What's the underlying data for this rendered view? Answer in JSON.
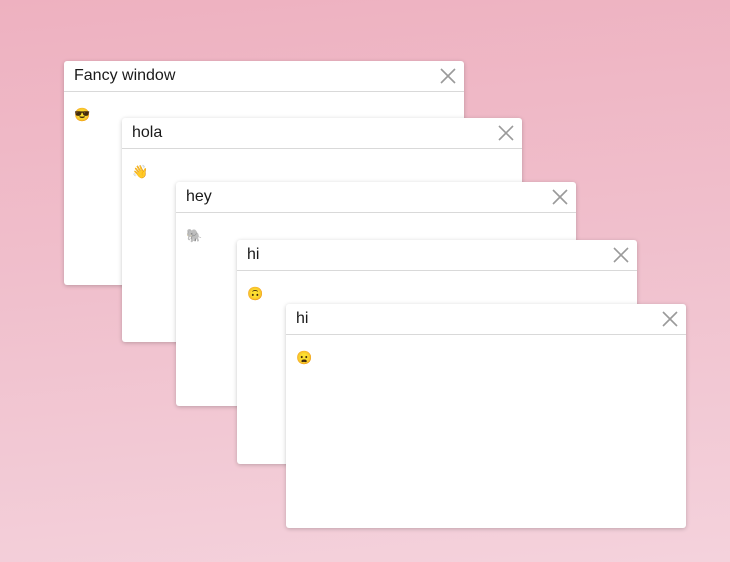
{
  "windows": [
    {
      "title": "Fancy window",
      "emoji": "😎",
      "emoji_name": "sunglasses-face-icon"
    },
    {
      "title": "hola",
      "emoji": "👋",
      "emoji_name": "waving-hand-icon"
    },
    {
      "title": "hey",
      "emoji": "🐘",
      "emoji_name": "elephant-icon"
    },
    {
      "title": "hi",
      "emoji": "🙃",
      "emoji_name": "upside-down-face-icon"
    },
    {
      "title": "hi",
      "emoji": "😦",
      "emoji_name": "frowning-face-icon"
    }
  ],
  "icons": {
    "close": "close-icon"
  },
  "colors": {
    "background_top": "#eeb1c0",
    "background_bottom": "#f4d2dc",
    "close_icon": "#9a9a9a"
  }
}
